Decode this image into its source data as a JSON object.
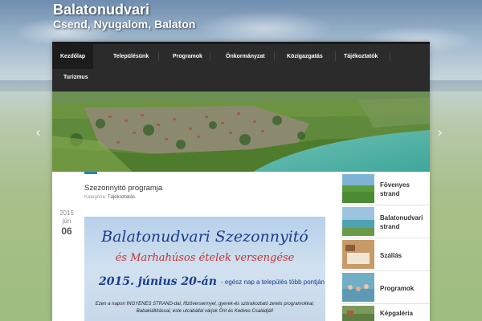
{
  "site": {
    "title": "Balatonudvari",
    "tagline": "Csend, Nyugalom, Balaton"
  },
  "nav": {
    "items": [
      {
        "label": "Kezdőlap",
        "active": true
      },
      {
        "label": "Településünk"
      },
      {
        "label": "Programok"
      },
      {
        "label": "Önkormányzat"
      },
      {
        "label": "Közigazgatás"
      },
      {
        "label": "Tájékoztatók"
      },
      {
        "label": "Turizmus"
      }
    ]
  },
  "slider": {
    "prev_icon": "chevron-left-icon",
    "next_icon": "chevron-right-icon",
    "prev_glyph": "‹",
    "next_glyph": "›"
  },
  "post": {
    "title": "Szezonnyitó programja",
    "meta_prefix": "Kategória:",
    "category": "Tájékoztatás",
    "date": {
      "year": "2015",
      "month": "jún",
      "day": "06"
    }
  },
  "poster": {
    "title": "Balatonudvari Szezonnyitó",
    "subtitle": "és Marhahúsos ételek versengése",
    "date": "2015. június 20-án",
    "date_rest": "- egész nap a település több pontján",
    "text": "Ezen a napon INGYENES STRAND-dal, főzőversennyel, gyerek-és szórakoztató zenés programokkal, Babakiállítással, este utcabállal várjuk Önt és Kedves Családját!"
  },
  "sidebar": {
    "items": [
      {
        "label": "Fövenyes strand"
      },
      {
        "label": "Balatonudvari strand"
      },
      {
        "label": "Szállás"
      },
      {
        "label": "Programok"
      },
      {
        "label": "Képgaléria"
      }
    ]
  },
  "colors": {
    "nav_bg": "#2b2b2b",
    "accent": "#2f7fb8",
    "poster_title": "#1a3d8c",
    "poster_sub": "#c23232"
  }
}
